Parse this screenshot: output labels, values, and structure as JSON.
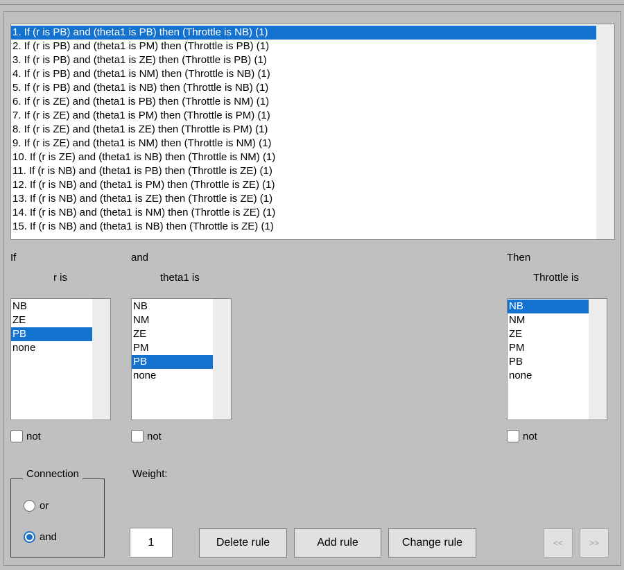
{
  "rules": [
    "1. If (r is PB) and (theta1 is PB) then (Throttle is NB) (1)",
    "2. If (r is PB) and (theta1 is PM) then (Throttle is PB) (1)",
    "3. If (r is PB) and (theta1 is ZE) then (Throttle is PB) (1)",
    "4. If (r is PB) and (theta1 is NM) then (Throttle is NB) (1)",
    "5. If (r is PB) and (theta1 is NB) then (Throttle is NB) (1)",
    "6. If (r is ZE) and (theta1 is PB) then (Throttle is NM) (1)",
    "7. If (r is ZE) and (theta1 is PM) then (Throttle is PM) (1)",
    "8. If (r is ZE) and (theta1 is ZE) then (Throttle is PM) (1)",
    "9. If (r is ZE) and (theta1 is NM) then (Throttle is NM) (1)",
    "10. If (r is ZE) and (theta1 is NB) then (Throttle is NM) (1)",
    "11. If (r is NB) and (theta1 is PB) then (Throttle is ZE) (1)",
    "12. If (r is NB) and (theta1 is PM) then (Throttle is ZE) (1)",
    "13. If (r is NB) and (theta1 is ZE) then (Throttle is ZE) (1)",
    "14. If (r is NB) and (theta1 is NM) then (Throttle is ZE) (1)",
    "15. If (r is NB) and (theta1 is NB) then (Throttle is ZE) (1)"
  ],
  "selected_rule": 0,
  "labels": {
    "if": "If",
    "and": "and",
    "then": "Then",
    "r_is": "r is",
    "theta1_is": "theta1 is",
    "throttle_is": "Throttle is",
    "not": "not",
    "connection": "Connection",
    "or": "or",
    "and_radio": "and",
    "weight": "Weight:"
  },
  "r_options": [
    "NB",
    "ZE",
    "PB",
    "none"
  ],
  "r_selected": 2,
  "theta1_options": [
    "NB",
    "NM",
    "ZE",
    "PM",
    "PB",
    "none"
  ],
  "theta1_selected": 4,
  "throttle_options": [
    "NB",
    "NM",
    "ZE",
    "PM",
    "PB",
    "none"
  ],
  "throttle_selected": 0,
  "weight_value": "1",
  "connection_selected": "and",
  "buttons": {
    "delete": "Delete rule",
    "add": "Add rule",
    "change": "Change rule",
    "prev": "<<",
    "next": ">>"
  },
  "colors": {
    "selection": "#1473d0",
    "background": "#c0c0c0"
  }
}
